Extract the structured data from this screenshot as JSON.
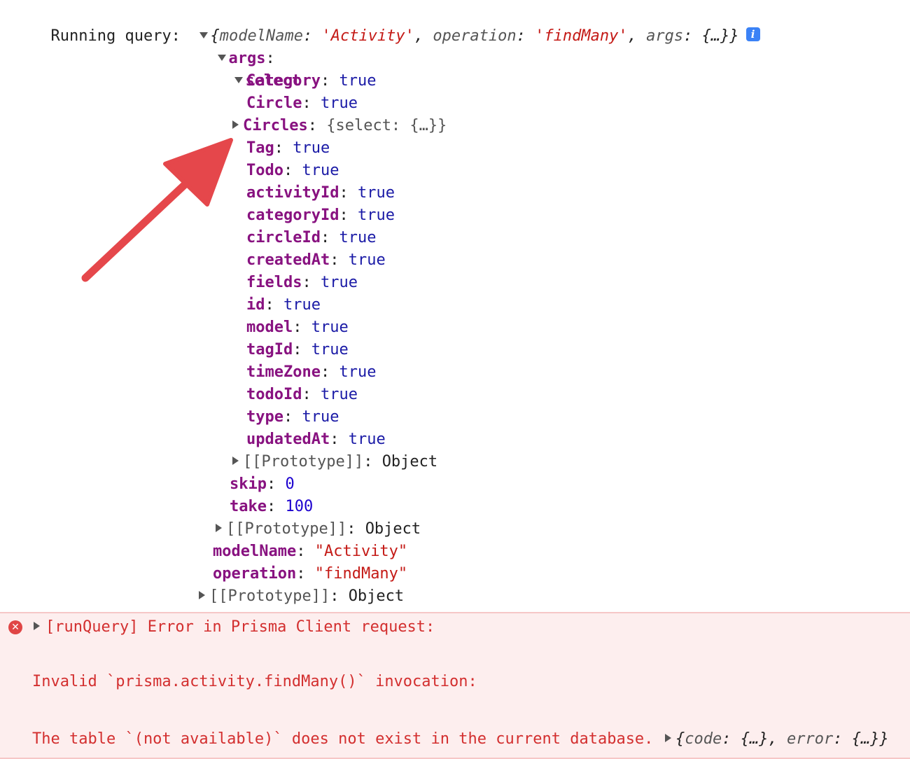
{
  "console": {
    "log_label": "Running query:",
    "summary": {
      "open": "{",
      "k1": "modelName",
      "v1": "'Activity'",
      "k2": "operation",
      "v2": "'findMany'",
      "k3": "args",
      "v3": "{…}",
      "close": "}"
    },
    "info_icon": "i",
    "args_key": "args",
    "select_key": "select",
    "select_fields": [
      {
        "key": "Category",
        "value": "true"
      },
      {
        "key": "Circle",
        "value": "true"
      },
      {
        "key": "Circles",
        "value": "{select: {…}}"
      },
      {
        "key": "Tag",
        "value": "true"
      },
      {
        "key": "Todo",
        "value": "true"
      },
      {
        "key": "activityId",
        "value": "true"
      },
      {
        "key": "categoryId",
        "value": "true"
      },
      {
        "key": "circleId",
        "value": "true"
      },
      {
        "key": "createdAt",
        "value": "true"
      },
      {
        "key": "fields",
        "value": "true"
      },
      {
        "key": "id",
        "value": "true"
      },
      {
        "key": "model",
        "value": "true"
      },
      {
        "key": "tagId",
        "value": "true"
      },
      {
        "key": "timeZone",
        "value": "true"
      },
      {
        "key": "todoId",
        "value": "true"
      },
      {
        "key": "type",
        "value": "true"
      },
      {
        "key": "updatedAt",
        "value": "true"
      }
    ],
    "prototype_label": "[[Prototype]]",
    "prototype_value": "Object",
    "skip": {
      "key": "skip",
      "value": "0"
    },
    "take": {
      "key": "take",
      "value": "100"
    },
    "modelName": {
      "key": "modelName",
      "value": "\"Activity\""
    },
    "operation": {
      "key": "operation",
      "value": "\"findMany\""
    }
  },
  "error": {
    "line1": "[runQuery] Error in Prisma Client request:",
    "line2": "Invalid `prisma.activity.findMany()` invocation:",
    "line3": "The table `(not available)` does not exist in the current database.",
    "obj_open": "{",
    "obj_k1": "code",
    "obj_v1": "{…}",
    "obj_k2": "error",
    "obj_v2": "{…}",
    "obj_close": "}"
  },
  "colors": {
    "annotation_arrow": "#e5474b",
    "error_background": "#fdeeee",
    "error_text": "#d32f2f",
    "info_badge": "#3b82f6"
  }
}
